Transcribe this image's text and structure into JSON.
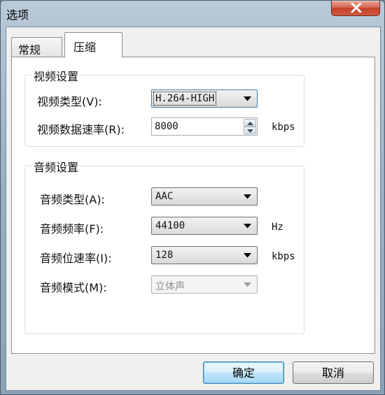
{
  "window": {
    "title": "选项"
  },
  "tabs": [
    {
      "label": "常规",
      "selected": false
    },
    {
      "label": "压缩",
      "selected": true
    }
  ],
  "video": {
    "group_title": "视频设置",
    "type_label": "视频类型(V):",
    "type_value": "H.264-HIGH",
    "rate_label": "视频数据速率(R):",
    "rate_value": "8000",
    "rate_unit": "kbps"
  },
  "audio": {
    "group_title": "音频设置",
    "type_label": "音频类型(A):",
    "type_value": "AAC",
    "freq_label": "音频频率(F):",
    "freq_value": "44100",
    "freq_unit": "Hz",
    "bitrate_label": "音频位速率(I):",
    "bitrate_value": "128",
    "bitrate_unit": "kbps",
    "mode_label": "音频模式(M):",
    "mode_value": "立体声"
  },
  "buttons": {
    "ok": "确定",
    "cancel": "取消"
  },
  "colors": {
    "accent": "#3c7fb1",
    "close": "#c2412b"
  }
}
